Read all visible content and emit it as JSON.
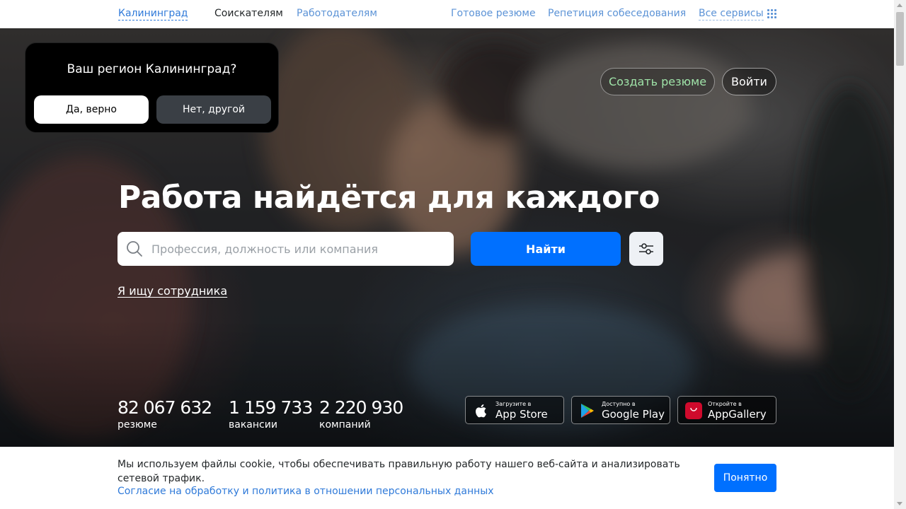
{
  "topbar": {
    "city": "Калининград",
    "seekers": "Соискателям",
    "employers": "Работодателям",
    "ready_resume": "Готовое резюме",
    "interview": "Репетиция собеседования",
    "all_services": "Все сервисы",
    "all_services_icon": "grid-icon"
  },
  "header": {
    "create_resume": "Создать резюме",
    "login": "Войти"
  },
  "region_popup": {
    "title": "Ваш регион Калининград?",
    "yes": "Да, верно",
    "no": "Нет, другой"
  },
  "hero": {
    "headline": "Работа найдётся для каждого",
    "search": {
      "placeholder": "Профессия, должность или компания",
      "value": "",
      "icon": "search-icon"
    },
    "find_button": "Найти",
    "filters_icon": "sliders-icon",
    "employer_link": "Я ищу сотрудника"
  },
  "stats": [
    {
      "value": "82 067 632",
      "label": "резюме"
    },
    {
      "value": "1 159 733",
      "label": "вакансии"
    },
    {
      "value": "2 220 930",
      "label": "компаний"
    }
  ],
  "stores": {
    "apple": {
      "small": "Загрузите в",
      "big": "App Store",
      "icon": "apple-icon"
    },
    "google": {
      "small": "Доступно в",
      "big": "Google Play",
      "icon": "google-play-icon"
    },
    "huawei": {
      "small": "Откройте в",
      "big": "AppGallery",
      "icon": "huawei-icon"
    }
  },
  "cookie": {
    "text": "Мы используем файлы cookie, чтобы обеспечивать правильную работу нашего веб-сайта и анализировать сетевой трафик.",
    "link": "Согласие на обработку и политика в отношении персональных данных",
    "ok": "Понятно"
  },
  "colors": {
    "accent": "#0070ff",
    "link": "#2f7ad9",
    "create_resume_text": "#9fe3a8"
  }
}
